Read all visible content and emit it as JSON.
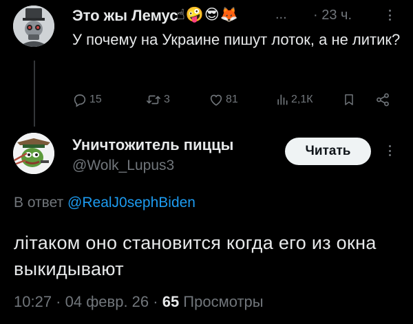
{
  "tweet": {
    "author_name": "Это жы Лемус",
    "author_emojis": "☝🤪😎🦊",
    "ellipsis": "...",
    "time": "· 23 ч.",
    "text": "У почему на Украине пишут лоток, а не литик?",
    "actions": {
      "replies": "15",
      "retweets": "3",
      "likes": "81",
      "views": "2,1К"
    }
  },
  "reply": {
    "author_name": "Уничтожитель пиццы",
    "handle": "@Wolk_Lupus3",
    "follow_label": "Читать",
    "reply_prefix": "В ответ",
    "reply_mention": "@RealJ0sephBiden",
    "text": "літаком оно становится когда его из окна выкидывают",
    "timestamp": "10:27 · 04 февр. 26 · ",
    "views_count": "65",
    "views_label": " Просмотры"
  },
  "colors": {
    "background": "#000000",
    "text_primary": "#e7e9ea",
    "text_secondary": "#71767b",
    "link": "#1d9bf0",
    "button_bg": "#eff3f4"
  },
  "icons": [
    "reply-icon",
    "retweet-icon",
    "like-icon",
    "views-icon",
    "bookmark-icon",
    "share-icon",
    "more-icon"
  ]
}
